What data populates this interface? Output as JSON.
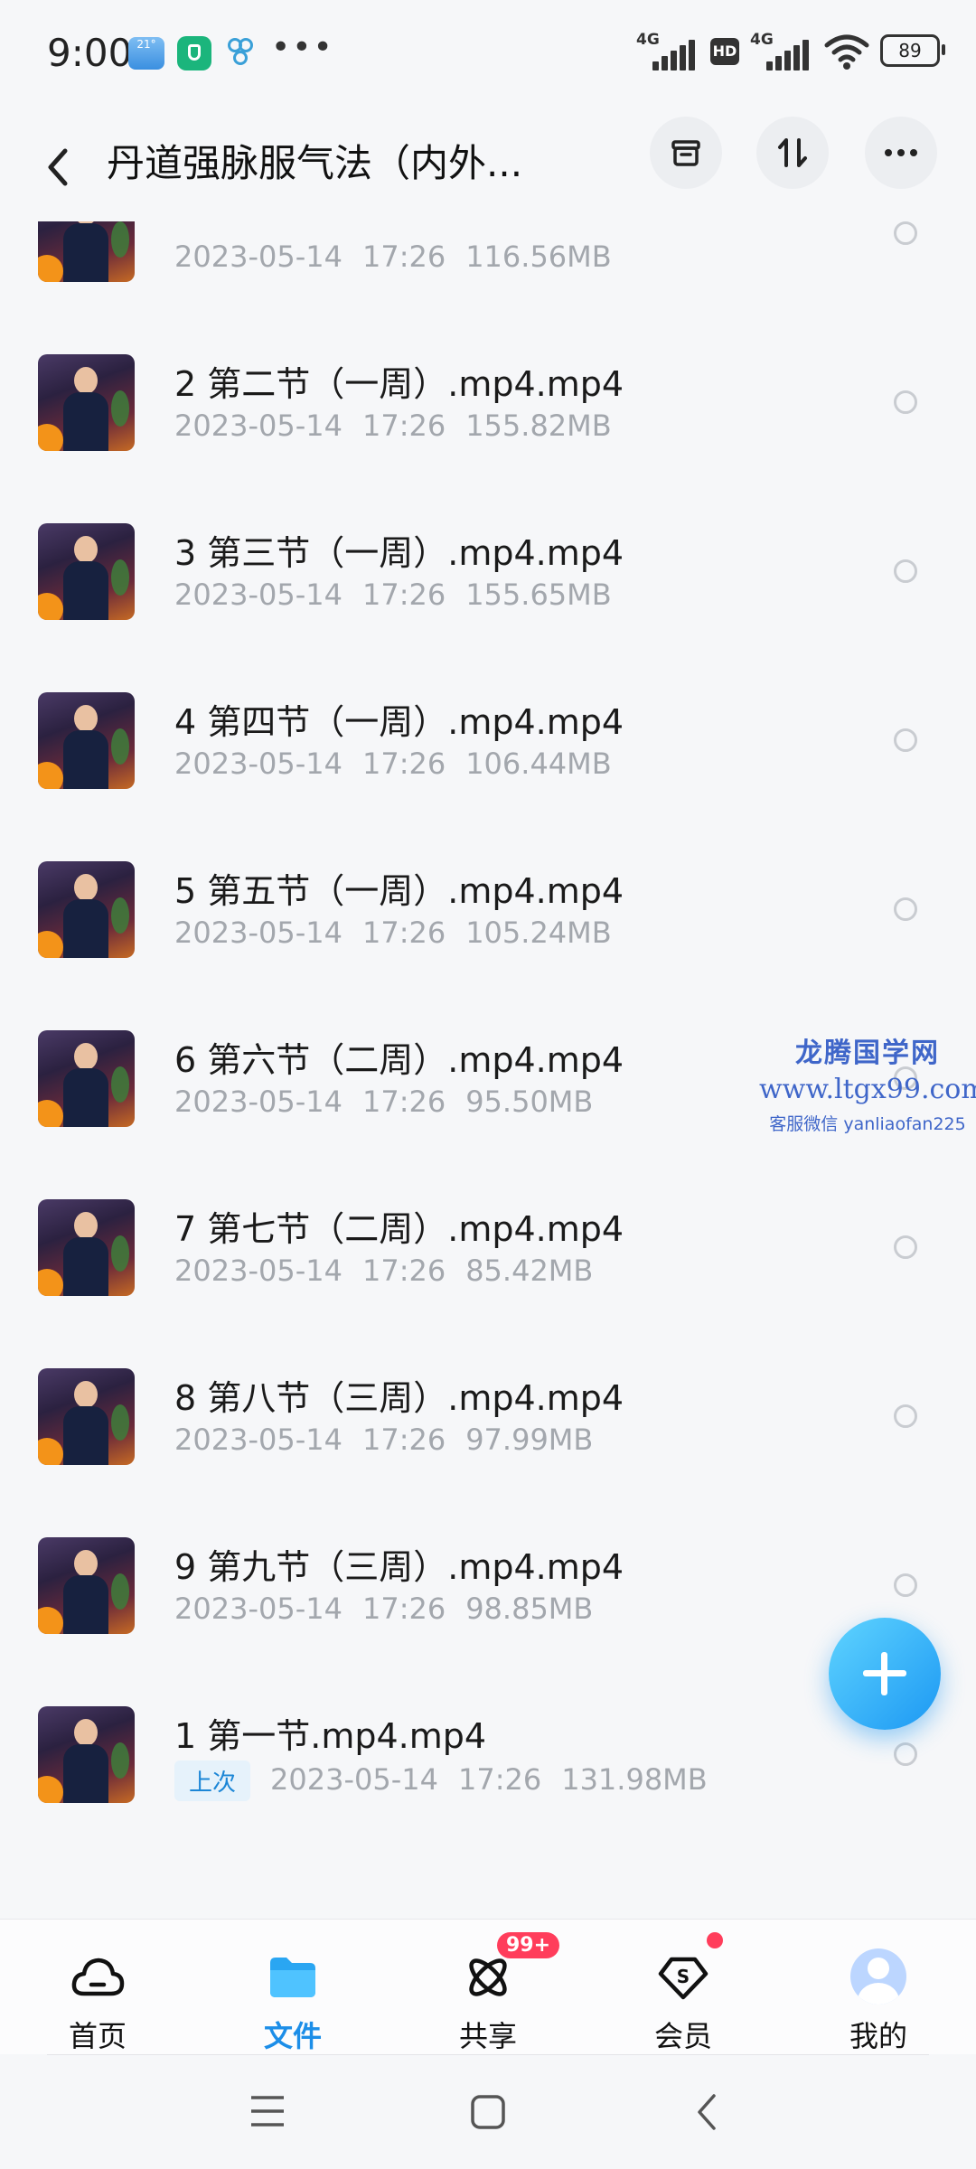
{
  "status_bar": {
    "time": "9:00",
    "weather_temp": "21°",
    "network1": "4G",
    "hd": "HD",
    "network2": "4G",
    "battery": "89"
  },
  "header": {
    "title": "丹道强脉服气法（内外..."
  },
  "files": [
    {
      "name": "",
      "date": "2023-05-14",
      "time": "17:26",
      "size": "116.56MB"
    },
    {
      "name": "2 第二节（一周）.mp4.mp4",
      "date": "2023-05-14",
      "time": "17:26",
      "size": "155.82MB"
    },
    {
      "name": "3 第三节（一周）.mp4.mp4",
      "date": "2023-05-14",
      "time": "17:26",
      "size": "155.65MB"
    },
    {
      "name": "4 第四节（一周）.mp4.mp4",
      "date": "2023-05-14",
      "time": "17:26",
      "size": "106.44MB"
    },
    {
      "name": "5 第五节（一周）.mp4.mp4",
      "date": "2023-05-14",
      "time": "17:26",
      "size": "105.24MB"
    },
    {
      "name": "6 第六节（二周）.mp4.mp4",
      "date": "2023-05-14",
      "time": "17:26",
      "size": "95.50MB"
    },
    {
      "name": "7 第七节（二周）.mp4.mp4",
      "date": "2023-05-14",
      "time": "17:26",
      "size": "85.42MB"
    },
    {
      "name": "8 第八节（三周）.mp4.mp4",
      "date": "2023-05-14",
      "time": "17:26",
      "size": "97.99MB"
    },
    {
      "name": "9 第九节（三周）.mp4.mp4",
      "date": "2023-05-14",
      "time": "17:26",
      "size": "98.85MB"
    },
    {
      "name": "1 第一节.mp4.mp4",
      "tag": "上次",
      "date": "2023-05-14",
      "time": "17:26",
      "size": "131.98MB"
    }
  ],
  "watermark": {
    "line1": "龙腾国学网",
    "line2": "www.ltgx99.com",
    "line3": "客服微信 yanliaofan225"
  },
  "bottom_nav": {
    "items": [
      {
        "label": "首页",
        "icon": "cloud-home-icon"
      },
      {
        "label": "文件",
        "icon": "folder-icon"
      },
      {
        "label": "共享",
        "icon": "atom-share-icon",
        "badge": "99+"
      },
      {
        "label": "会员",
        "icon": "member-diamond-icon"
      },
      {
        "label": "我的",
        "icon": "avatar-icon"
      }
    ]
  },
  "colors": {
    "accent": "#1c8ee8",
    "badge": "#ff3d5b",
    "meta_text": "#a3a7ad"
  }
}
